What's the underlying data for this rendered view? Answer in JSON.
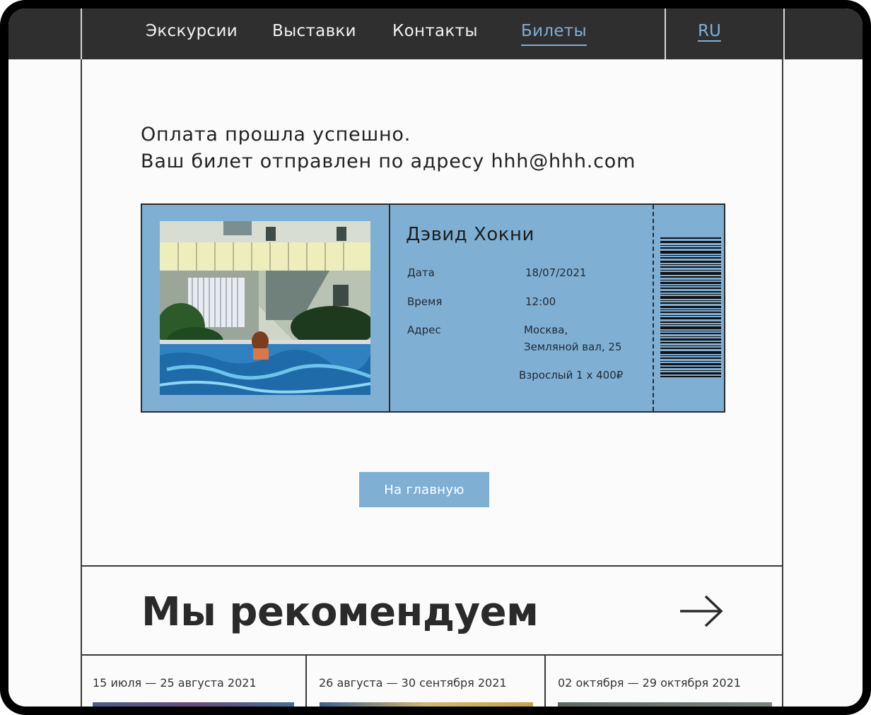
{
  "nav": {
    "items": [
      {
        "label": "Экскурсии"
      },
      {
        "label": "Выставки"
      },
      {
        "label": "Контакты"
      },
      {
        "label": "Билеты",
        "active": true
      }
    ],
    "lang": "RU"
  },
  "message": {
    "line1": "Оплата прошла успешно.",
    "line2": "Ваш билет отправлен по адресу hhh@hhh.com"
  },
  "ticket": {
    "title": "Дэвид Хокни",
    "date_label": "Дата",
    "date_value": "18/07/2021",
    "time_label": "Время",
    "time_value": "12:00",
    "address_label": "Адрес",
    "address_line1": "Москва,",
    "address_line2": "Земляной вал, 25",
    "price": "Взрослый 1 x 400₽"
  },
  "home_button": "На главную",
  "recommend": {
    "title": "Мы рекомендуем",
    "cards": [
      {
        "date": "15 июля — 25 августа 2021"
      },
      {
        "date": "26 августа — 30 сентября 2021"
      },
      {
        "date": "02 октября — 29 октября 2021"
      }
    ]
  },
  "colors": {
    "accent": "#7fb0d4",
    "header_bg": "#2f2f2f",
    "text": "#2a2a2a"
  }
}
